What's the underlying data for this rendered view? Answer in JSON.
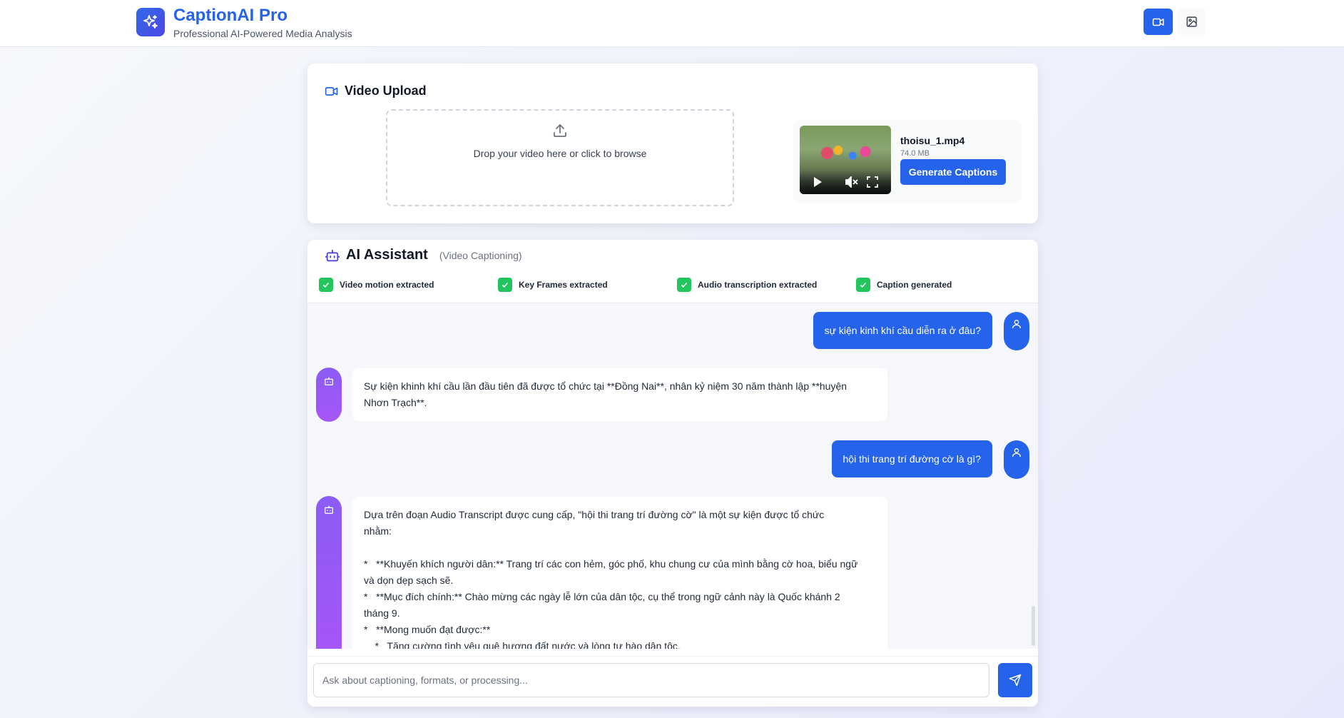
{
  "header": {
    "title": "CaptionAI Pro",
    "subtitle": "Professional AI-Powered Media Analysis",
    "logo_icon": "sparkles-icon",
    "mode_buttons": [
      {
        "icon": "video-icon",
        "active": true
      },
      {
        "icon": "image-icon",
        "active": false
      }
    ]
  },
  "upload": {
    "title": "Video Upload",
    "drop_text": "Drop your video here or click to browse",
    "file": {
      "name": "thoisu_1.mp4",
      "size": "74.0 MB"
    },
    "generate_label": "Generate Captions"
  },
  "assistant": {
    "title": "AI Assistant",
    "subtitle": "(Video Captioning)",
    "steps": [
      {
        "label": "Video motion extracted",
        "done": true
      },
      {
        "label": "Key Frames extracted",
        "done": true
      },
      {
        "label": "Audio transcription extracted",
        "done": true
      },
      {
        "label": "Caption generated",
        "done": true
      }
    ],
    "messages": [
      {
        "role": "user",
        "text": "sự kiện kinh khí cầu diễn ra ở đâu?"
      },
      {
        "role": "bot",
        "lines": [
          "Sự kiện khinh khí cầu lần đầu tiên đã được tổ chức tại **Đồng Nai**, nhân kỷ niệm 30 năm thành lập **huyện",
          "Nhơn Trạch**."
        ]
      },
      {
        "role": "user",
        "text": "hội thi trang trí đường cờ là gì?"
      },
      {
        "role": "bot",
        "lines": [
          "Dựa trên đoạn Audio Transcript được cung cấp, \"hội thi trang trí đường cờ\" là một sự kiện được tổ chức",
          "nhằm:",
          "",
          "*   **Khuyến khích người dân:** Trang trí các con hẻm, góc phố, khu chung cư của mình bằng cờ hoa, biểu ngữ",
          "và dọn dẹp sạch sẽ.",
          "*   **Mục đích chính:** Chào mừng các ngày lễ lớn của dân tộc, cụ thể trong ngữ cảnh này là Quốc khánh 2",
          "tháng 9.",
          "*   **Mong muốn đạt được:**",
          "    *   Tăng cường tình yêu quê hương đất nước và lòng tự hào dân tộc."
        ]
      }
    ],
    "input_placeholder": "Ask about captioning, formats, or processing...",
    "send_icon": "send-icon"
  },
  "colors": {
    "primary": "#2563eb",
    "success": "#22c55e",
    "bot_avatar": "#8b5cf6"
  }
}
